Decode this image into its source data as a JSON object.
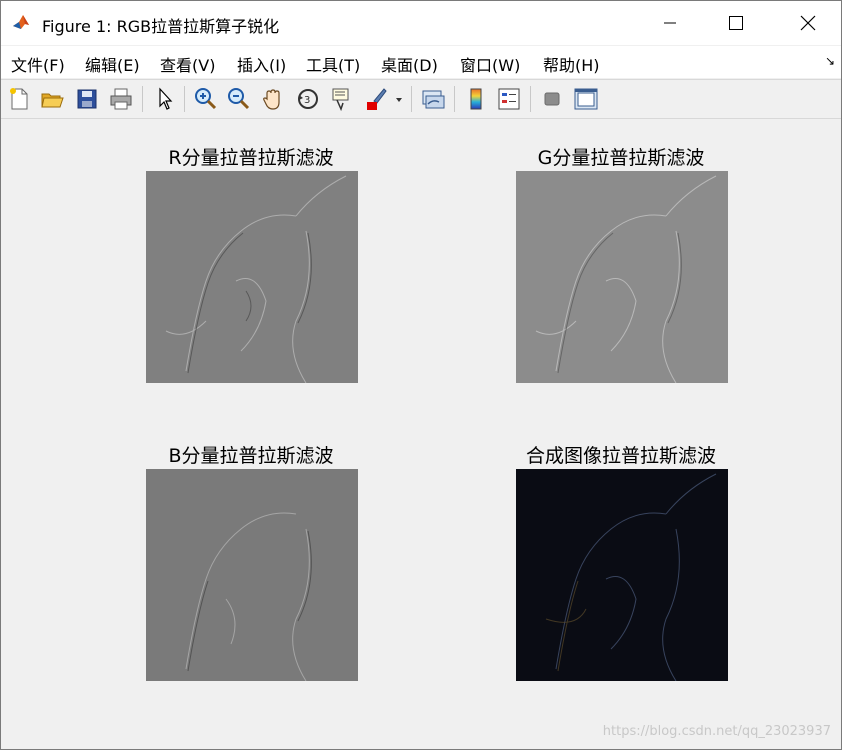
{
  "window": {
    "title": "Figure 1: RGB拉普拉斯算子锐化"
  },
  "menu": [
    "文件(F)",
    "编辑(E)",
    "查看(V)",
    "插入(I)",
    "工具(T)",
    "桌面(D)",
    "窗口(W)",
    "帮助(H)"
  ],
  "axes": [
    {
      "title": "R分量拉普拉斯滤波"
    },
    {
      "title": "G分量拉普拉斯滤波"
    },
    {
      "title": "B分量拉普拉斯滤波"
    },
    {
      "title": "合成图像拉普拉斯滤波"
    }
  ],
  "watermark": "https://blog.csdn.net/qq_23023937",
  "colors": {
    "r_image_bg": "#808080",
    "g_image_bg": "#8c8c8c",
    "b_image_bg": "#7a7a7a",
    "composite_bg": "#0a0c14",
    "paint_accent": "#e00000"
  }
}
